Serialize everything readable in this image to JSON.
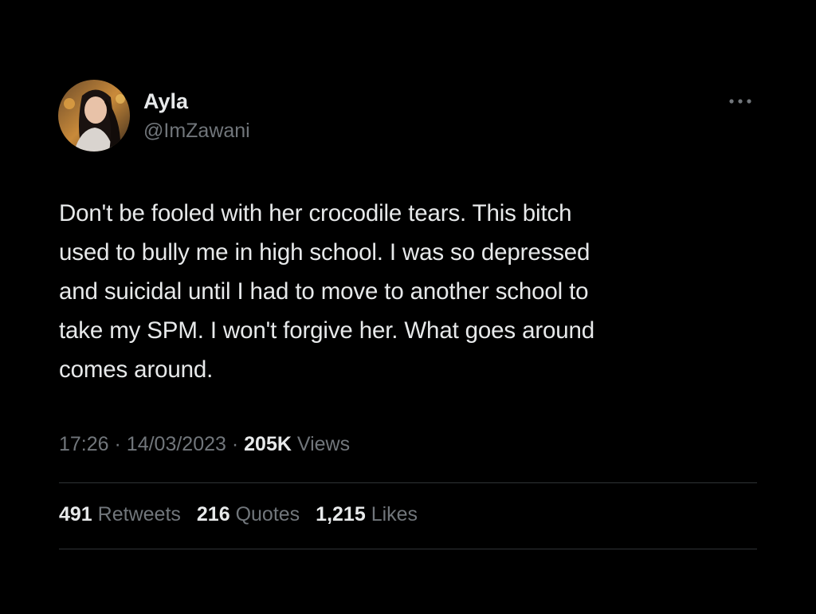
{
  "colors": {
    "background": "#000000",
    "primary_text": "#e7e9ea",
    "secondary_text": "#71767b",
    "divider": "#2f3336"
  },
  "author": {
    "display_name": "Ayla",
    "handle": "@ImZawani",
    "avatar_icon": "profile-photo"
  },
  "more_icon": "ellipsis-horizontal",
  "tweet": {
    "text": "Don't be fooled with her crocodile tears. This bitch\nused to bully me in high school. I was so depressed\nand suicidal until I had to move to another school to\ntake my SPM. I won't forgive her. What goes around\ncomes around."
  },
  "meta": {
    "time": "17:26",
    "separator": "·",
    "date": "14/03/2023",
    "views_count": "205K",
    "views_label": "Views"
  },
  "stats": {
    "retweets_count": "491",
    "retweets_label": "Retweets",
    "quotes_count": "216",
    "quotes_label": "Quotes",
    "likes_count": "1,215",
    "likes_label": "Likes"
  }
}
